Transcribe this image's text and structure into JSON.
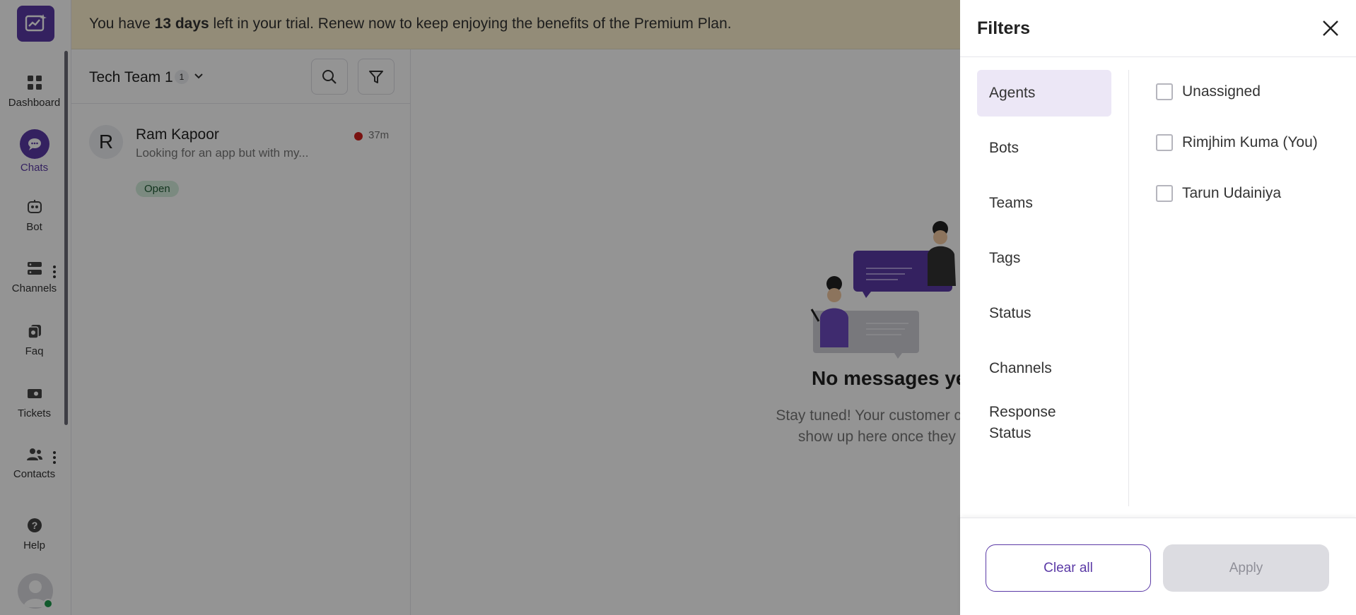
{
  "banner": {
    "prefix": "You have ",
    "days": "13 days",
    "suffix": " left in your trial. Renew now to keep enjoying the benefits of the Premium Plan."
  },
  "sidebar": {
    "items": [
      {
        "label": "Dashboard",
        "icon": "dashboard-icon"
      },
      {
        "label": "Chats",
        "icon": "chat-icon",
        "active": true
      },
      {
        "label": "Bot",
        "icon": "bot-icon"
      },
      {
        "label": "Channels",
        "icon": "channels-icon"
      },
      {
        "label": "Faq",
        "icon": "faq-icon"
      },
      {
        "label": "Tickets",
        "icon": "tickets-icon"
      },
      {
        "label": "Contacts",
        "icon": "contacts-icon"
      }
    ],
    "help_label": "Help"
  },
  "chatlist": {
    "team_name": "Tech Team 1",
    "team_count": "1",
    "chats": [
      {
        "initial": "R",
        "name": "Ram Kapoor",
        "preview": "Looking for an app but with my...",
        "time": "37m",
        "status": "Open"
      }
    ]
  },
  "main": {
    "empty_title": "No messages yet",
    "empty_desc_line1": "Stay tuned! Your customer conver",
    "empty_desc_line2": "show up here once they be"
  },
  "filters": {
    "title": "Filters",
    "categories": [
      "Agents",
      "Bots",
      "Teams",
      "Tags",
      "Status",
      "Channels",
      "Response Status"
    ],
    "active_category": "Agents",
    "options": [
      "Unassigned",
      "Rimjhim Kuma (You)",
      "Tarun Udainiya"
    ],
    "clear_label": "Clear all",
    "apply_label": "Apply"
  },
  "colors": {
    "brand": "#5b3aa6",
    "banner_bg": "#fdf2cf",
    "status_open_bg": "#d5eedd",
    "unread_dot": "#d0201c",
    "online": "#1e9b4d"
  }
}
